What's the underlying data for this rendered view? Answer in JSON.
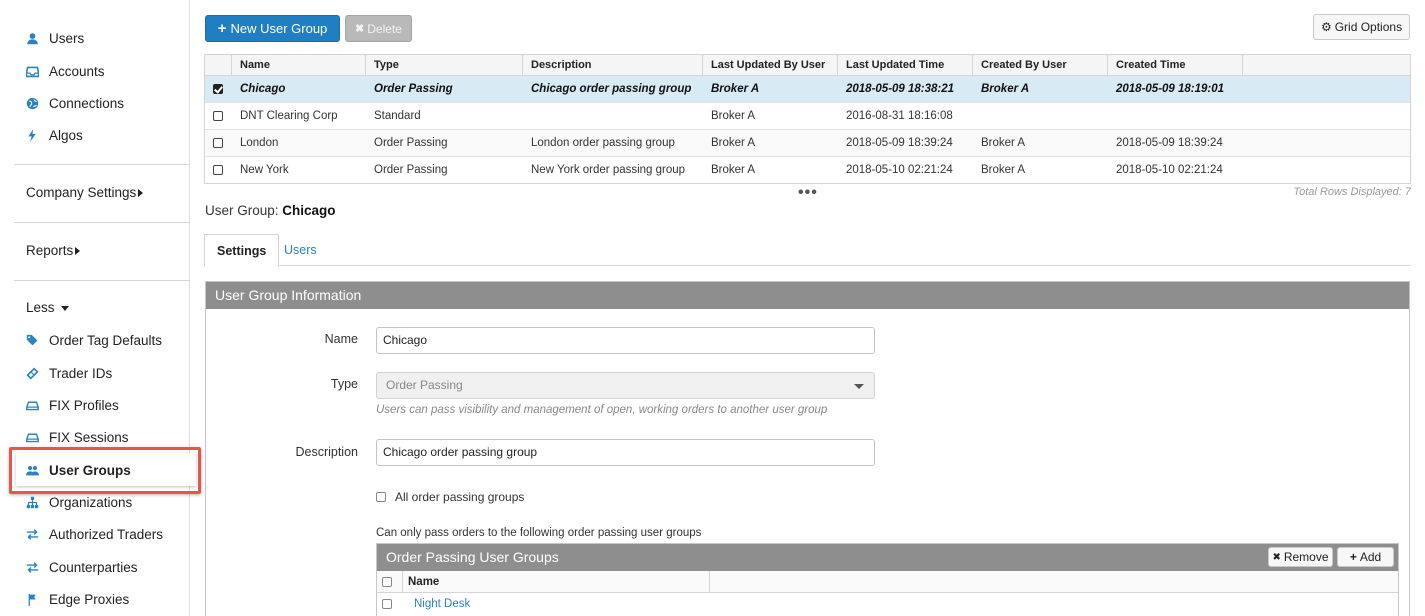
{
  "sidebar": {
    "items_top": [
      {
        "label": "Users",
        "icon": "user-icon"
      },
      {
        "label": "Accounts",
        "icon": "inbox-icon"
      },
      {
        "label": "Connections",
        "icon": "globe-icon"
      },
      {
        "label": "Algos",
        "icon": "bolt-icon"
      }
    ],
    "company_settings": "Company Settings",
    "reports": "Reports",
    "less": "Less",
    "items_more": [
      {
        "label": "Order Tag Defaults",
        "icon": "tags-icon"
      },
      {
        "label": "Trader IDs",
        "icon": "ticket-icon"
      },
      {
        "label": "FIX Profiles",
        "icon": "hdd-icon"
      },
      {
        "label": "FIX Sessions",
        "icon": "hdd-icon"
      },
      {
        "label": "User Groups",
        "icon": "users-icon"
      },
      {
        "label": "Organizations",
        "icon": "sitemap-icon"
      },
      {
        "label": "Authorized Traders",
        "icon": "exchange-icon"
      },
      {
        "label": "Counterparties",
        "icon": "exchange-icon"
      },
      {
        "label": "Edge Proxies",
        "icon": "flag-icon"
      }
    ]
  },
  "toolbar": {
    "new_label": "New User Group",
    "delete_label": "Delete",
    "grid_options_label": "Grid Options"
  },
  "grid": {
    "columns": [
      "Name",
      "Type",
      "Description",
      "Last Updated By User",
      "Last Updated Time",
      "Created By User",
      "Created Time"
    ],
    "rows": [
      {
        "name": "Chicago",
        "type": "Order Passing",
        "description": "Chicago order passing group",
        "updated_by": "Broker A",
        "updated_time": "2018-05-09 18:38:21",
        "created_by": "Broker A",
        "created_time": "2018-05-09 18:19:01",
        "checked": true
      },
      {
        "name": "DNT Clearing Corp",
        "type": "Standard",
        "description": "",
        "updated_by": "Broker A",
        "updated_time": "2016-08-31 18:16:08",
        "created_by": "",
        "created_time": "",
        "checked": false
      },
      {
        "name": "London",
        "type": "Order Passing",
        "description": "London order passing group",
        "updated_by": "Broker A",
        "updated_time": "2018-05-09 18:39:24",
        "created_by": "Broker A",
        "created_time": "2018-05-09 18:39:24",
        "checked": false
      },
      {
        "name": "New York",
        "type": "Order Passing",
        "description": "New York order passing group",
        "updated_by": "Broker A",
        "updated_time": "2018-05-10 02:21:24",
        "created_by": "Broker A",
        "created_time": "2018-05-10 02:21:24",
        "checked": false
      }
    ],
    "more": "•••",
    "total_rows": "Total Rows Displayed: 7"
  },
  "detail": {
    "prefix": "User Group:",
    "name": "Chicago",
    "tabs": [
      "Settings",
      "Users"
    ]
  },
  "form": {
    "section_title": "User Group Information",
    "name_label": "Name",
    "name_value": "Chicago",
    "type_label": "Type",
    "type_value": "Order Passing",
    "type_hint": "Users can pass visibility and management of open, working orders to another user group",
    "description_label": "Description",
    "description_value": "Chicago order passing group",
    "all_groups_label": "All order passing groups",
    "restrict_text": "Can only pass orders to the following order passing user groups"
  },
  "opg": {
    "title": "Order Passing User Groups",
    "remove_label": "Remove",
    "add_label": "Add",
    "column": "Name",
    "rows": [
      "Night Desk"
    ]
  }
}
